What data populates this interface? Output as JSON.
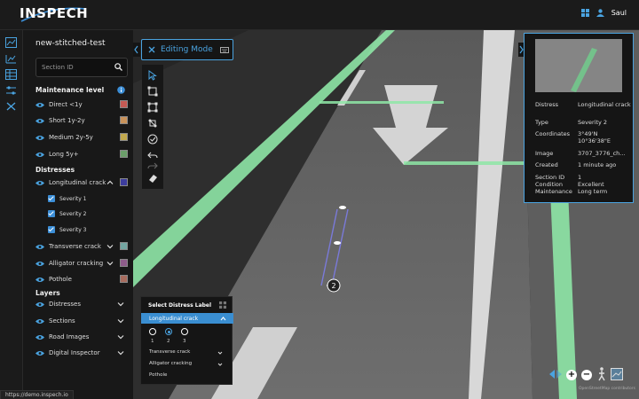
{
  "app": {
    "logo": "INSPECH",
    "user_name": "Saul"
  },
  "sidebar": {
    "project_title": "new-stitched-test",
    "search_placeholder": "Section ID",
    "maintenance": {
      "title": "Maintenance level",
      "items": [
        {
          "label": "Direct <1y",
          "color": "#c45a54"
        },
        {
          "label": "Short 1y-2y",
          "color": "#c9925a"
        },
        {
          "label": "Medium 2y-5y",
          "color": "#c2a94e"
        },
        {
          "label": "Long 5y+",
          "color": "#6b9e6a"
        }
      ]
    },
    "distresses": {
      "title": "Distresses",
      "items": [
        {
          "label": "Longitudinal crack",
          "color": "#3d3d9e"
        },
        {
          "label": "Transverse crack",
          "color": "#74a5a1"
        },
        {
          "label": "Alligator cracking",
          "color": "#8e5c8a"
        },
        {
          "label": "Pothole",
          "color": "#a86c5e"
        }
      ],
      "severities": [
        "Severity 1",
        "Severity 2",
        "Severity 3"
      ]
    },
    "layers": {
      "title": "Layers",
      "items": [
        {
          "label": "Distresses"
        },
        {
          "label": "Sections"
        },
        {
          "label": "Road Images"
        },
        {
          "label": "Digital Inspector"
        }
      ]
    }
  },
  "editing": {
    "label": "Editing Mode"
  },
  "map": {
    "marker_number": "2",
    "attribution": "OpenStreetMap contributors"
  },
  "info_panel": {
    "rows": [
      {
        "key": "Distress",
        "value": "Longitudinal crack"
      },
      {
        "key": "Type",
        "value": "Severity 2"
      },
      {
        "key": "Coordinates",
        "value": "3°49'N 10°36'38\"E"
      },
      {
        "key": "Image",
        "value": "3707_3776_ch..."
      },
      {
        "key": "Created",
        "value": "1 minute ago"
      },
      {
        "key": "Section ID",
        "value": "1"
      },
      {
        "key": "Condition",
        "value": "Excellent"
      },
      {
        "key": "Maintenance",
        "value": "Long term"
      }
    ]
  },
  "label_panel": {
    "title": "Select Distress Label",
    "selected": "Longitudinal crack",
    "radios": [
      "1",
      "2",
      "3"
    ],
    "options": [
      "Transverse crack",
      "Alligator cracking",
      "Pothole"
    ]
  },
  "status": {
    "url": "https://demo.inspech.io"
  },
  "colors": {
    "accent": "#4aa3e0",
    "lane_green": "#8ee6a6"
  }
}
